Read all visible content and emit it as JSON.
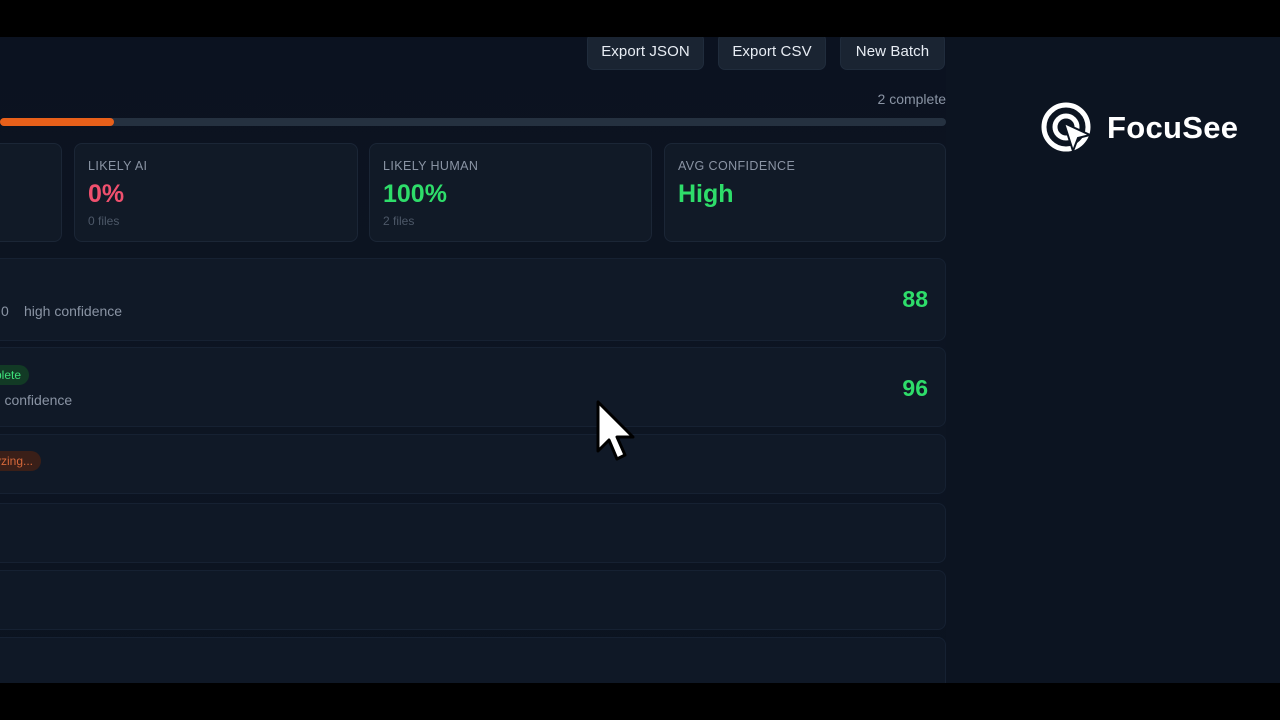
{
  "toolbar": {
    "export_json_label": "Export JSON",
    "export_csv_label": "Export CSV",
    "new_batch_label": "New Batch"
  },
  "progress": {
    "complete_text": "2 complete",
    "fraction": 0.12,
    "color": "#e8601a"
  },
  "stats": {
    "likely_ai": {
      "label": "LIKELY AI",
      "value": "0%",
      "sub": "0 files"
    },
    "likely_human": {
      "label": "LIKELY HUMAN",
      "value": "100%",
      "sub": "2 files"
    },
    "avg_confidence": {
      "label": "AVG CONFIDENCE",
      "value": "High"
    }
  },
  "results": [
    {
      "prefix": "0",
      "confidence": "high confidence",
      "score": "88"
    },
    {
      "status": "plete",
      "confidence": "gh confidence",
      "score": "96"
    },
    {
      "status": "yzing..."
    }
  ],
  "brand": {
    "name": "FocuSee"
  },
  "colors": {
    "ai_red": "#f0506e",
    "human_green": "#2edd6a",
    "accent_orange": "#e8601a"
  }
}
